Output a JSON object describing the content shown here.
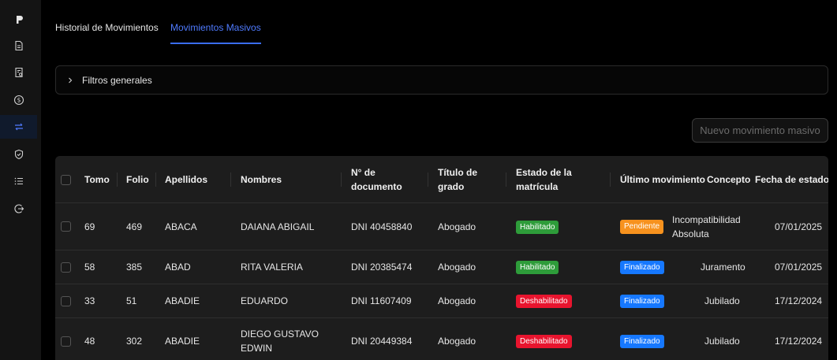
{
  "sidebar": {
    "items": [
      {
        "icon": "logo-icon"
      },
      {
        "icon": "document-icon"
      },
      {
        "icon": "certificate-icon"
      },
      {
        "icon": "dollar-icon"
      },
      {
        "icon": "transfer-icon",
        "active": true
      },
      {
        "icon": "shield-check-icon"
      },
      {
        "icon": "list-icon"
      },
      {
        "icon": "logout-icon"
      }
    ]
  },
  "tabs": [
    {
      "label": "Historial de Movimientos",
      "active": false
    },
    {
      "label": "Movimientos Masivos",
      "active": true
    }
  ],
  "filters": {
    "label": "Filtros generales"
  },
  "actions": {
    "mass_movement_label": "Nuevo movimiento masivo"
  },
  "table": {
    "headers": {
      "tomo": "Tomo",
      "folio": "Folio",
      "apellidos": "Apellidos",
      "nombres": "Nombres",
      "documento_1": "N° de",
      "documento_2": "documento",
      "titulo_1": "Título de",
      "titulo_2": "grado",
      "estado_1": "Estado de la",
      "estado_2": "matrícula",
      "ultimo": "Último movimiento",
      "concepto": "Concepto",
      "fecha": "Fecha de estado"
    },
    "rows": [
      {
        "tomo": "69",
        "folio": "469",
        "apellidos": "ABACA",
        "nombres_1": "DAIANA ABIGAIL",
        "nombres_2": "",
        "documento": "DNI 40458840",
        "titulo": "Abogado",
        "estado": "Habilitado",
        "ultimo": "Pendiente",
        "concepto_1": "Incompatibilidad",
        "concepto_2": "Absoluta",
        "fecha": "07/01/2025"
      },
      {
        "tomo": "58",
        "folio": "385",
        "apellidos": "ABAD",
        "nombres_1": "RITA VALERIA",
        "nombres_2": "",
        "documento": "DNI 20385474",
        "titulo": "Abogado",
        "estado": "Habilitado",
        "ultimo": "Finalizado",
        "concepto_1": "Juramento",
        "concepto_2": "",
        "fecha": "07/01/2025"
      },
      {
        "tomo": "33",
        "folio": "51",
        "apellidos": "ABADIE",
        "nombres_1": "EDUARDO",
        "nombres_2": "",
        "documento": "DNI 11607409",
        "titulo": "Abogado",
        "estado": "Deshabilitado",
        "ultimo": "Finalizado",
        "concepto_1": "Jubilado",
        "concepto_2": "",
        "fecha": "17/12/2024"
      },
      {
        "tomo": "48",
        "folio": "302",
        "apellidos": "ABADIE",
        "nombres_1": "DIEGO GUSTAVO",
        "nombres_2": "EDWIN",
        "documento": "DNI 20449384",
        "titulo": "Abogado",
        "estado": "Deshabilitado",
        "ultimo": "Finalizado",
        "concepto_1": "Jubilado",
        "concepto_2": "",
        "fecha": "17/12/2024"
      }
    ]
  },
  "colors": {
    "accent": "#4f7bff",
    "habilitado": "#2e9c3a",
    "deshabilitado": "#e8142e",
    "pendiente": "#f7921e",
    "finalizado": "#1678ff"
  }
}
